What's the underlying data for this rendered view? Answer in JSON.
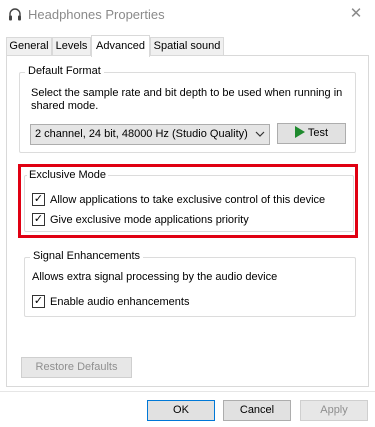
{
  "window": {
    "title": "Headphones Properties",
    "icon": "headphones-icon",
    "close_glyph": "✕"
  },
  "tabs": [
    {
      "label": "General",
      "active": false
    },
    {
      "label": "Levels",
      "active": false
    },
    {
      "label": "Advanced",
      "active": true
    },
    {
      "label": "Spatial sound",
      "active": false
    }
  ],
  "default_format": {
    "legend": "Default Format",
    "description": "Select the sample rate and bit depth to be used when running in shared mode.",
    "format_value": "2 channel, 24 bit, 48000 Hz (Studio Quality)",
    "test_label": "Test"
  },
  "exclusive_mode": {
    "legend": "Exclusive Mode",
    "allow_label": "Allow applications to take exclusive control of this device",
    "allow_checked": true,
    "priority_label": "Give exclusive mode applications priority",
    "priority_checked": true
  },
  "signal_enhancements": {
    "legend": "Signal Enhancements",
    "description": "Allows extra signal processing by the audio device",
    "enable_label": "Enable audio enhancements",
    "enable_checked": true
  },
  "restore_label": "Restore Defaults",
  "footer": {
    "ok_label": "OK",
    "cancel_label": "Cancel",
    "apply_label": "Apply"
  },
  "colors": {
    "highlight": "#e00012",
    "test_icon": "#1f8a2e"
  }
}
